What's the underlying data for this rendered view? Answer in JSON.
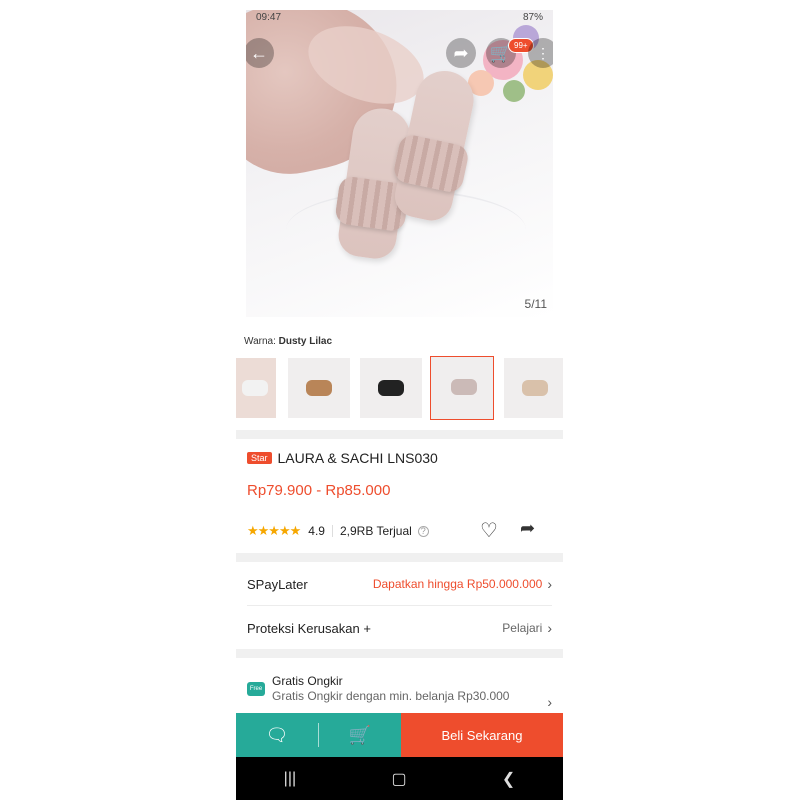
{
  "status_bar": {
    "time": "09:47",
    "battery": "87%"
  },
  "gallery": {
    "counter": "5/11",
    "cart_badge": "99+"
  },
  "variant": {
    "label": "Warna:",
    "value": "Dusty Lilac"
  },
  "product": {
    "badge": "Star",
    "title": "LAURA & SACHI LNS030",
    "price": "Rp79.900 - Rp85.000",
    "stars": "★★★★★",
    "rating": "4.9",
    "sold": "2,9RB Terjual"
  },
  "rows": {
    "spaylater_label": "SPayLater",
    "spaylater_value": "Dapatkan hingga Rp50.000.000",
    "protection_label": "Proteksi Kerusakan +",
    "protection_value": "Pelajari"
  },
  "shipping": {
    "icon_text": "Free",
    "title": "Gratis Ongkir",
    "subtitle": "Gratis Ongkir dengan min. belanja Rp30.000"
  },
  "bottom_bar": {
    "buy_label": "Beli Sekarang"
  },
  "colors": {
    "accent": "#ee4d2d",
    "teal": "#26aa99",
    "star": "#f6a700"
  }
}
